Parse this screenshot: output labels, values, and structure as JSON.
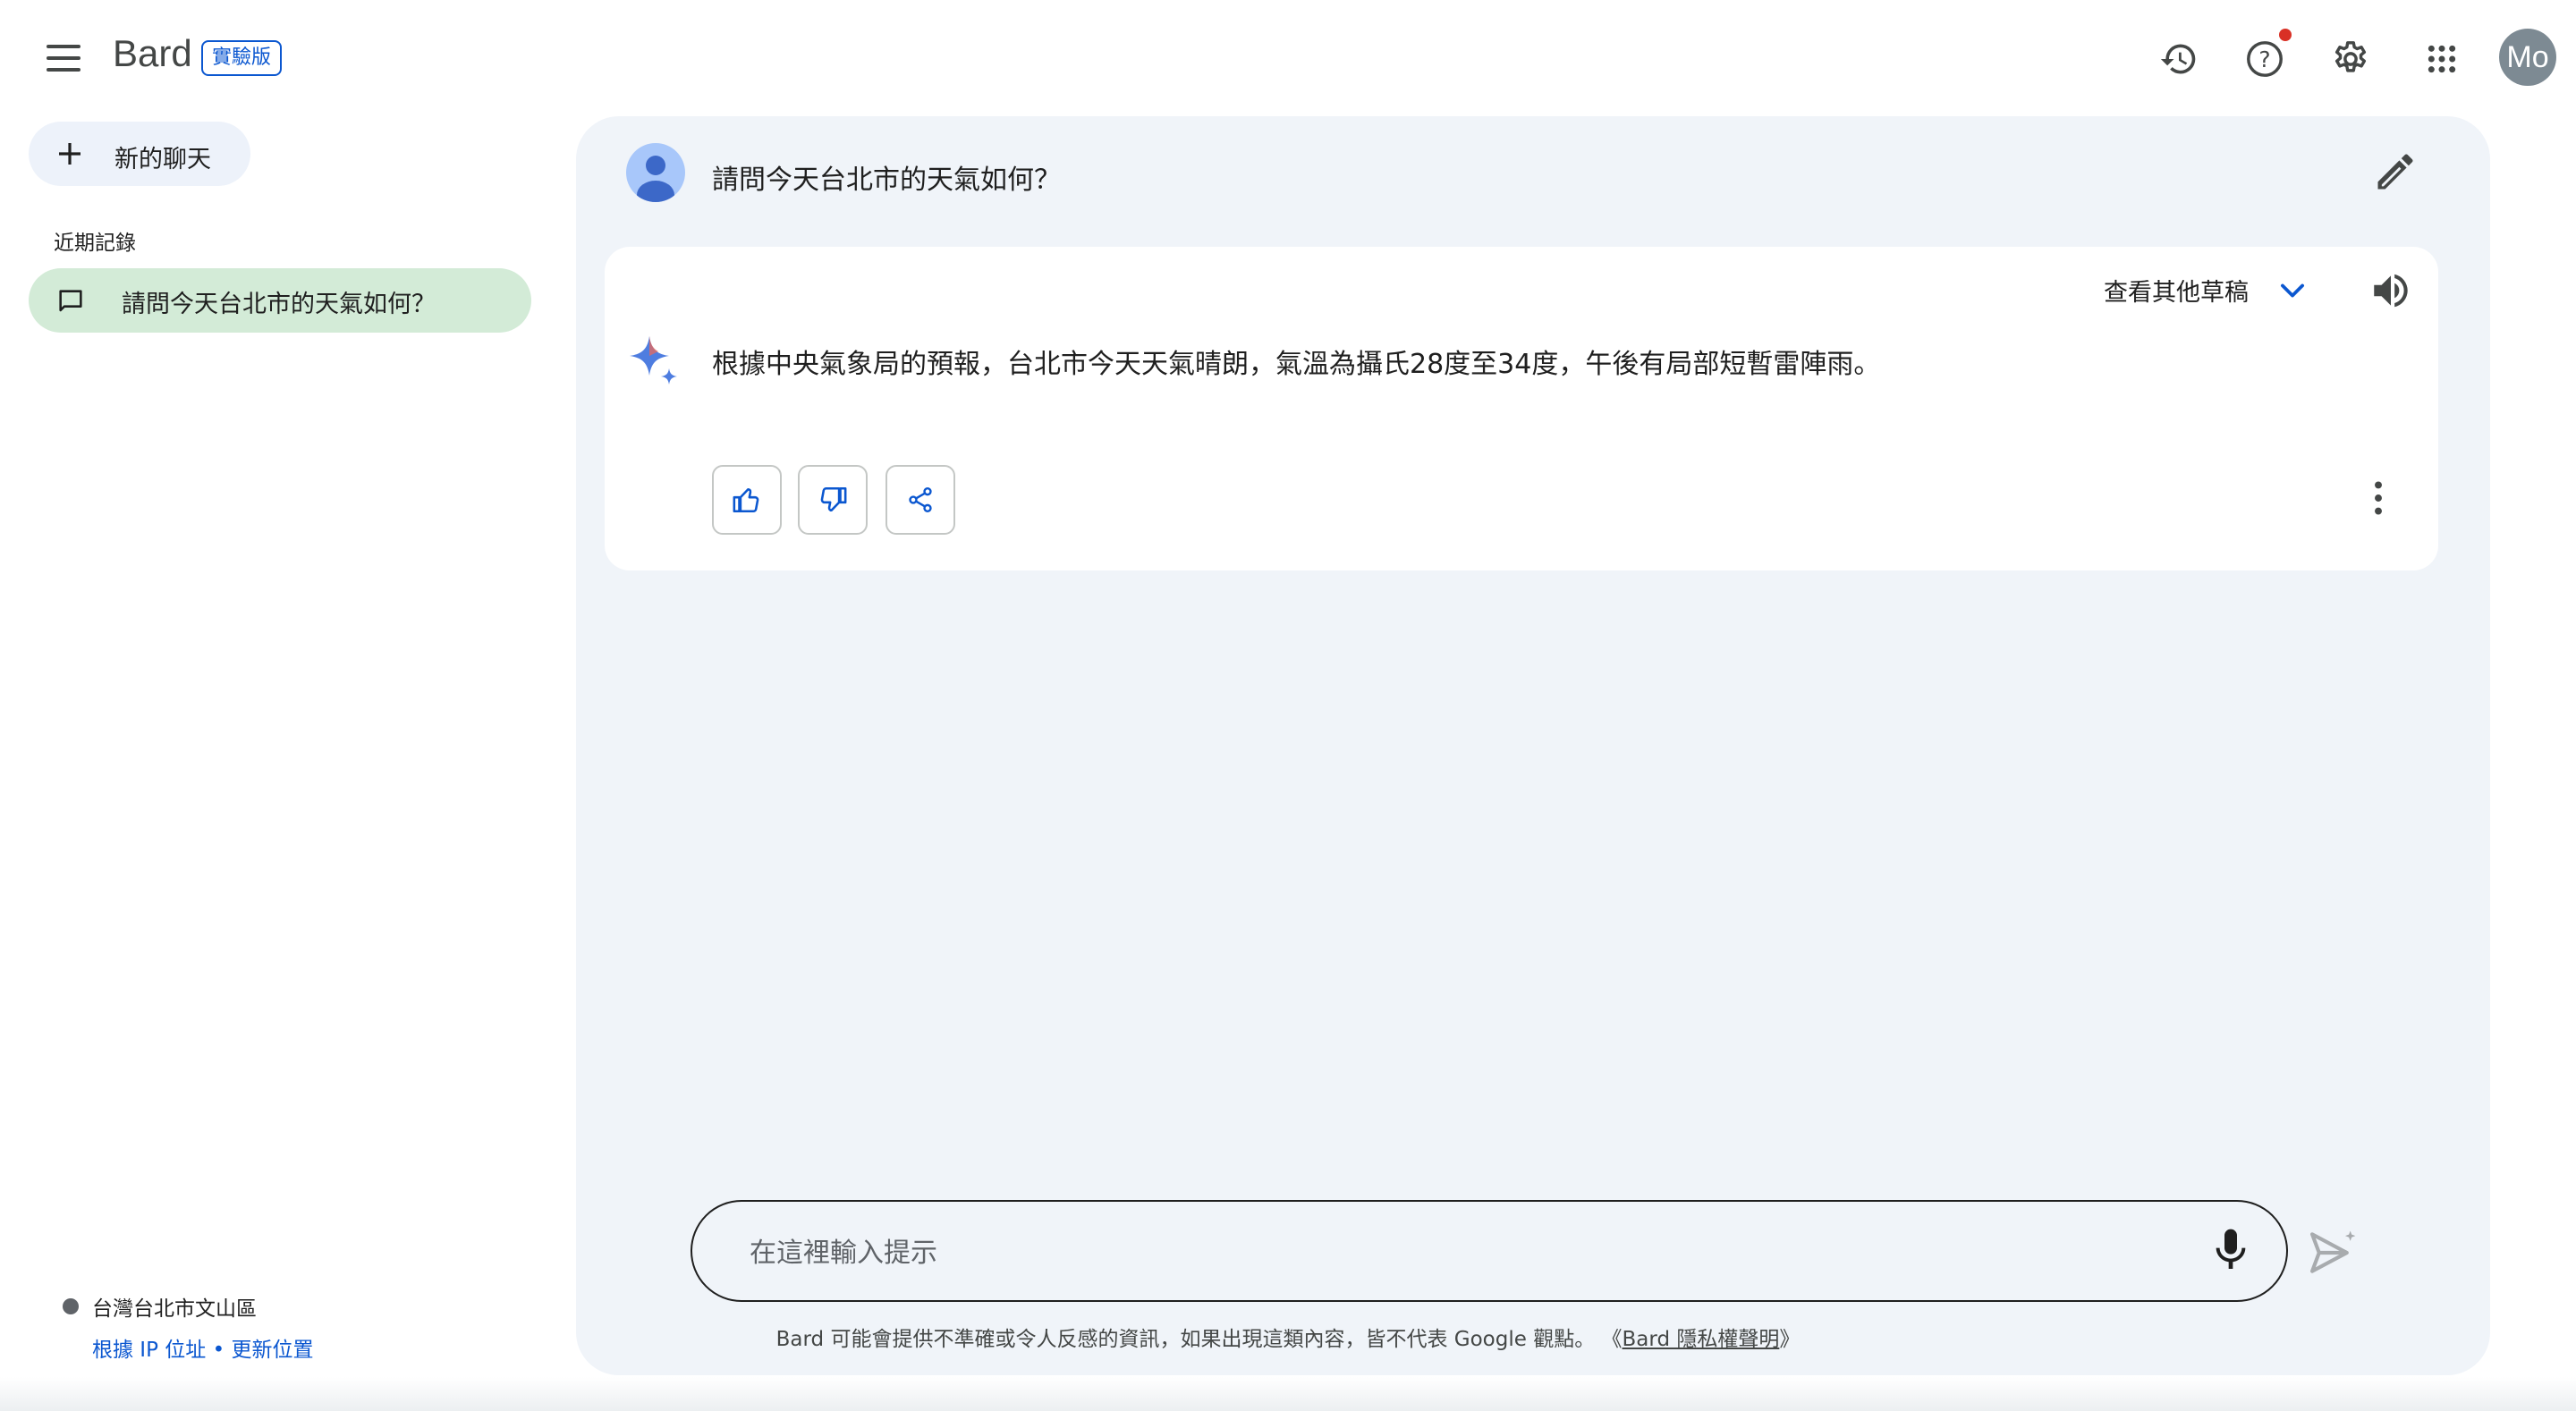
{
  "header": {
    "brand": "Bard",
    "badge": "實驗版",
    "avatar_initials": "Mo",
    "icons": [
      "menu-icon",
      "history-icon",
      "help-icon",
      "settings-icon",
      "apps-icon"
    ]
  },
  "sidebar": {
    "new_chat_label": "新的聊天",
    "recent_title": "近期記錄",
    "recent_items": [
      {
        "label": "請問今天台北市的天氣如何？"
      }
    ],
    "location": {
      "name": "台灣台北市文山區",
      "based_on": "根據 IP 位址",
      "separator": " • ",
      "update": "更新位置"
    }
  },
  "conversation": {
    "user_query": "請問今天台北市的天氣如何？",
    "drafts_label": "查看其他草稿",
    "response_text": "根據中央氣象局的預報，台北市今天天氣晴朗，氣溫為攝氏28度至34度，午後有局部短暫雷陣雨。"
  },
  "input": {
    "placeholder": "在這裡輸入提示"
  },
  "disclaimer": {
    "text": "Bard 可能會提供不準確或令人反感的資訊，如果出現這類內容，皆不代表 Google 觀點。",
    "privacy_prefix": "《",
    "privacy_link": "Bard 隱私權聲明",
    "privacy_suffix": "》"
  },
  "colors": {
    "accent": "#0b57d0",
    "panel_bg": "#f0f4f9",
    "selected_item_bg": "#d3ebd7",
    "notification": "#d93025"
  }
}
